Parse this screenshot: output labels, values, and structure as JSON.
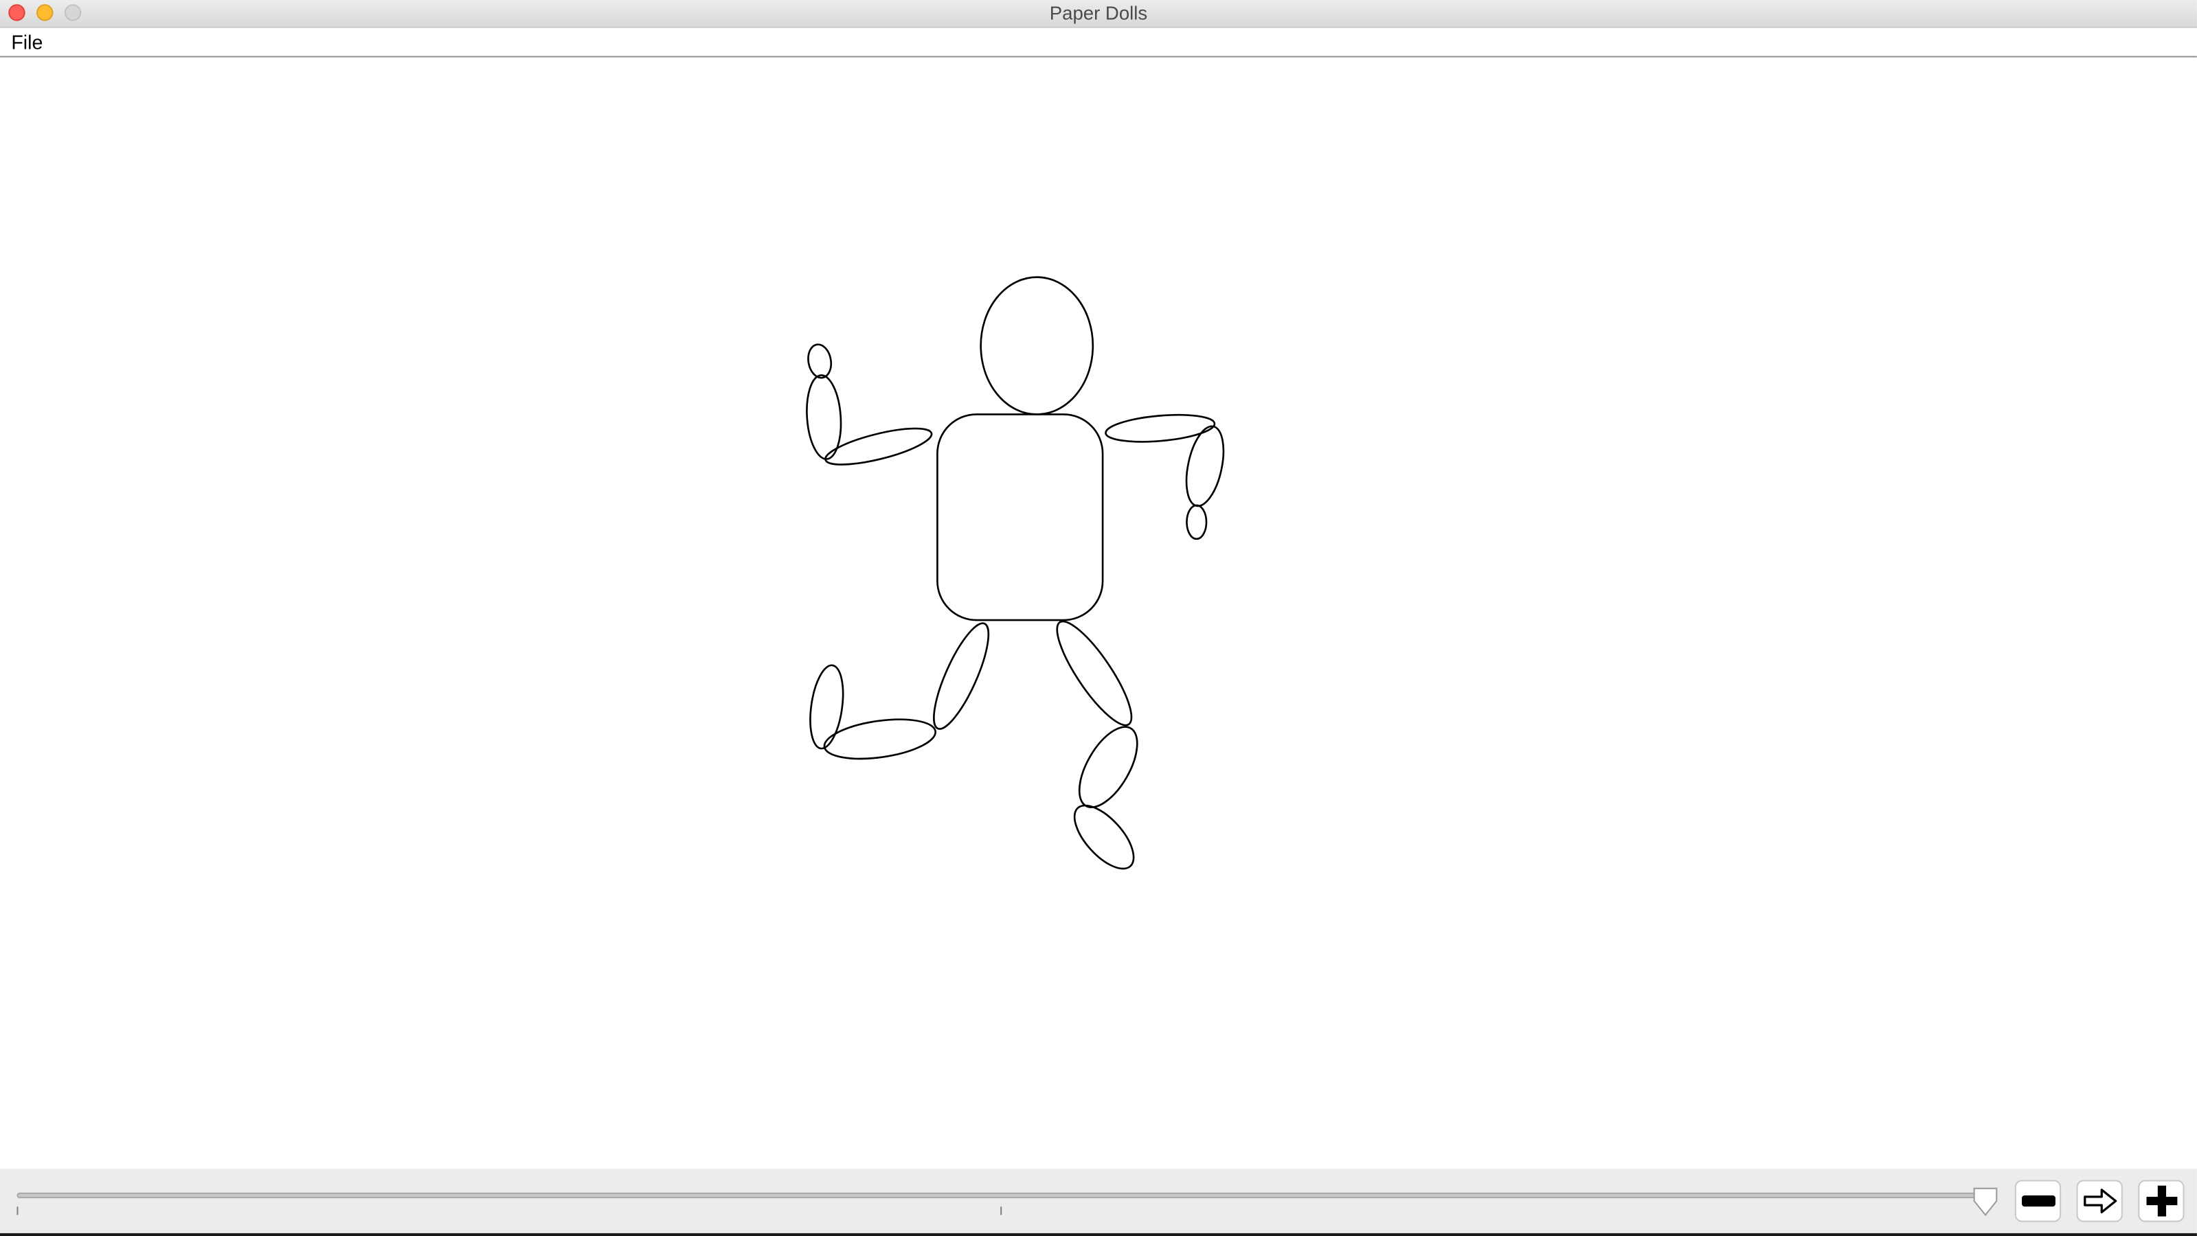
{
  "window": {
    "title": "Paper Dolls"
  },
  "menubar": {
    "items": [
      {
        "label": "File"
      }
    ]
  },
  "timeline": {
    "position": 1.0
  },
  "toolbar": {
    "buttons": [
      {
        "name": "remove-frame-button",
        "icon": "minus-icon"
      },
      {
        "name": "next-frame-button",
        "icon": "arrow-right-icon"
      },
      {
        "name": "add-frame-button",
        "icon": "plus-icon"
      }
    ]
  }
}
